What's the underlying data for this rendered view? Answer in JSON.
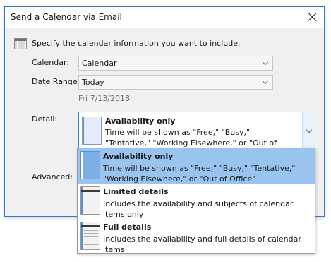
{
  "window": {
    "title": "Send a Calendar via Email",
    "close_icon": "close-icon"
  },
  "instruction": "Specify the calendar information you want to include.",
  "fields": {
    "calendar": {
      "label": "Calendar:",
      "value": "Calendar"
    },
    "date_range": {
      "label": "Date Range:",
      "value": "Today",
      "date_note": "Fri 7/13/2018"
    },
    "detail": {
      "label": "Detail:",
      "selected_name": "Availability only",
      "selected_desc": "Time will be shown as \"Free,\" \"Busy,\" \"Tentative,\" \"Working Elsewhere,\" or \"Out of Office\""
    },
    "advanced": {
      "label": "Advanced:"
    }
  },
  "detail_options": [
    {
      "name": "Availability only",
      "desc": "Time will be shown as \"Free,\" \"Busy,\" \"Tentative,\" \"Working Elsewhere,\" or \"Out of Office\"",
      "icon": "availability-icon",
      "selected": true
    },
    {
      "name": "Limited details",
      "desc": "Includes the availability and subjects of calendar items only",
      "icon": "limited-details-icon",
      "selected": false
    },
    {
      "name": "Full details",
      "desc": "Includes the availability and full details of calendar items",
      "icon": "full-details-icon",
      "selected": false
    }
  ],
  "colors": {
    "accent": "#2b79d0",
    "selection": "#99c4ee",
    "dialog_bg": "#f0f0f0"
  }
}
